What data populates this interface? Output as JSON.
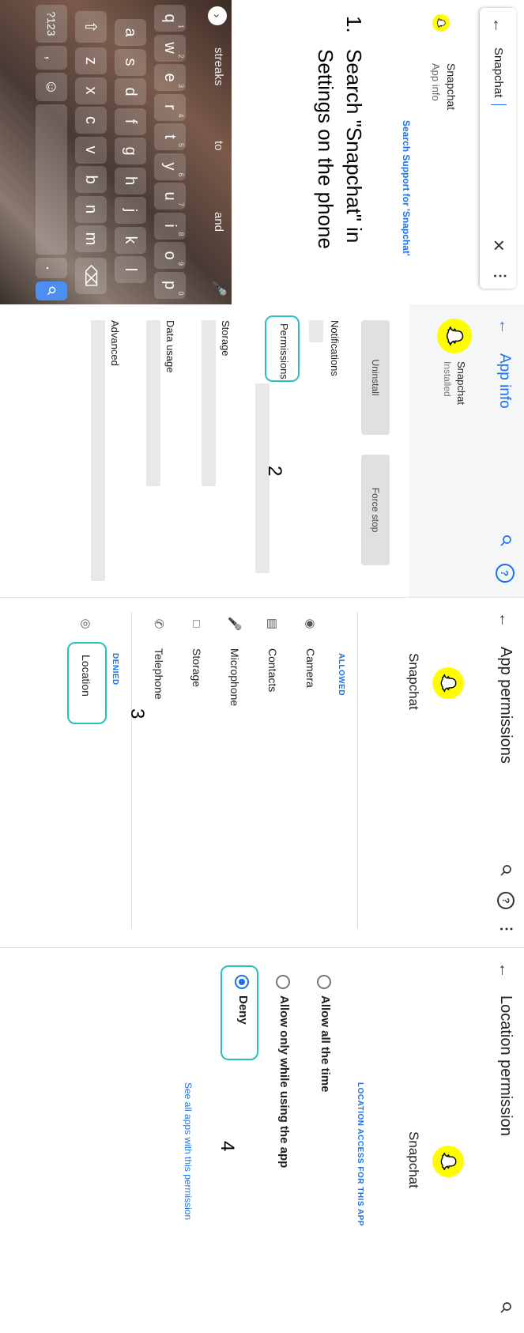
{
  "search_panel": {
    "query": "Snapchat",
    "result_title": "Snapchat",
    "result_subtitle": "App info",
    "support_link": "Search Support for 'Snapchat'",
    "instruction_number": "1.",
    "instruction_line1": "Search \"Snapchat\" in",
    "instruction_line2": "Settings on the phone",
    "keyboard": {
      "suggestions": [
        "streaks",
        "to",
        "and"
      ],
      "row1": [
        {
          "k": "q",
          "n": "1"
        },
        {
          "k": "w",
          "n": "2"
        },
        {
          "k": "e",
          "n": "3"
        },
        {
          "k": "r",
          "n": "4"
        },
        {
          "k": "t",
          "n": "5"
        },
        {
          "k": "y",
          "n": "6"
        },
        {
          "k": "u",
          "n": "7"
        },
        {
          "k": "i",
          "n": "8"
        },
        {
          "k": "o",
          "n": "9"
        },
        {
          "k": "p",
          "n": "0"
        }
      ],
      "row2": [
        "a",
        "s",
        "d",
        "f",
        "g",
        "h",
        "j",
        "k",
        "l"
      ],
      "row3": [
        "z",
        "x",
        "c",
        "v",
        "b",
        "n",
        "m"
      ],
      "symbols_key": "?123",
      "comma_key": ",",
      "period_key": "."
    }
  },
  "app_info": {
    "title": "App info",
    "app_name": "Snapchat",
    "app_status": "Installed",
    "uninstall": "Uninstall",
    "force_stop": "Force stop",
    "notifications": "Notifications",
    "permissions": "Permissions",
    "storage": "Storage",
    "data_usage": "Data usage",
    "advanced": "Advanced",
    "step_label": "2",
    "accent": "#1a73e8",
    "highlight": "#2bbfbf"
  },
  "app_permissions": {
    "title": "App permissions",
    "app_name": "Snapchat",
    "allowed_header": "ALLOWED",
    "allowed": [
      "Camera",
      "Contacts",
      "Microphone",
      "Storage",
      "Telephone"
    ],
    "denied_header": "DENIED",
    "denied": [
      "Location"
    ],
    "step_label": "3"
  },
  "location_permission": {
    "title": "Location permission",
    "app_name": "Snapchat",
    "section_header": "LOCATION ACCESS FOR THIS APP",
    "options": [
      "Allow all the time",
      "Allow only while using the app",
      "Deny"
    ],
    "selected": "Deny",
    "see_all": "See all apps with this permission",
    "step_label": "4"
  }
}
